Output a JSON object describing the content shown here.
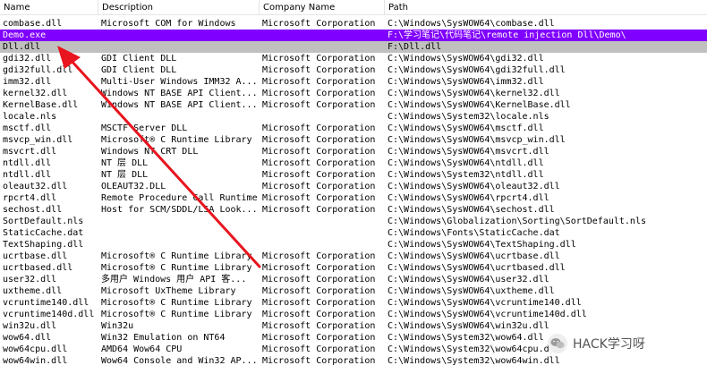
{
  "columns": [
    "Name",
    "Description",
    "Company Name",
    "Path"
  ],
  "rows": [
    {
      "name": "combase.dll",
      "description": "Microsoft COM for Windows",
      "company": "Microsoft Corporation",
      "path": "C:\\Windows\\SysWOW64\\combase.dll"
    },
    {
      "name": "Demo.exe",
      "description": "",
      "company": "",
      "path": "F:\\学习笔记\\代码笔记\\remote injection Dll\\Demo\\",
      "highlight": "purple"
    },
    {
      "name": "Dll.dll",
      "description": "",
      "company": "",
      "path": "F:\\Dll.dll",
      "highlight": "gray"
    },
    {
      "name": "gdi32.dll",
      "description": "GDI Client DLL",
      "company": "Microsoft Corporation",
      "path": "C:\\Windows\\SysWOW64\\gdi32.dll"
    },
    {
      "name": "gdi32full.dll",
      "description": "GDI Client DLL",
      "company": "Microsoft Corporation",
      "path": "C:\\Windows\\SysWOW64\\gdi32full.dll"
    },
    {
      "name": "imm32.dll",
      "description": "Multi-User Windows IMM32 A...",
      "company": "Microsoft Corporation",
      "path": "C:\\Windows\\SysWOW64\\imm32.dll"
    },
    {
      "name": "kernel32.dll",
      "description": "Windows NT BASE API Client...",
      "company": "Microsoft Corporation",
      "path": "C:\\Windows\\SysWOW64\\kernel32.dll"
    },
    {
      "name": "KernelBase.dll",
      "description": "Windows NT BASE API Client...",
      "company": "Microsoft Corporation",
      "path": "C:\\Windows\\SysWOW64\\KernelBase.dll"
    },
    {
      "name": "locale.nls",
      "description": "",
      "company": "",
      "path": "C:\\Windows\\System32\\locale.nls"
    },
    {
      "name": "msctf.dll",
      "description": "MSCTF Server DLL",
      "company": "Microsoft Corporation",
      "path": "C:\\Windows\\SysWOW64\\msctf.dll"
    },
    {
      "name": "msvcp_win.dll",
      "description": "Microsoft® C Runtime Library",
      "company": "Microsoft Corporation",
      "path": "C:\\Windows\\SysWOW64\\msvcp_win.dll"
    },
    {
      "name": "msvcrt.dll",
      "description": "Windows NT CRT DLL",
      "company": "Microsoft Corporation",
      "path": "C:\\Windows\\SysWOW64\\msvcrt.dll"
    },
    {
      "name": "ntdll.dll",
      "description": "NT 层 DLL",
      "company": "Microsoft Corporation",
      "path": "C:\\Windows\\SysWOW64\\ntdll.dll"
    },
    {
      "name": "ntdll.dll",
      "description": "NT 层 DLL",
      "company": "Microsoft Corporation",
      "path": "C:\\Windows\\System32\\ntdll.dll"
    },
    {
      "name": "oleaut32.dll",
      "description": "OLEAUT32.DLL",
      "company": "Microsoft Corporation",
      "path": "C:\\Windows\\SysWOW64\\oleaut32.dll"
    },
    {
      "name": "rpcrt4.dll",
      "description": "Remote Procedure Call Runtime",
      "company": "Microsoft Corporation",
      "path": "C:\\Windows\\SysWOW64\\rpcrt4.dll"
    },
    {
      "name": "sechost.dll",
      "description": "Host for SCM/SDDL/LSA Look...",
      "company": "Microsoft Corporation",
      "path": "C:\\Windows\\SysWOW64\\sechost.dll"
    },
    {
      "name": "SortDefault.nls",
      "description": "",
      "company": "",
      "path": "C:\\Windows\\Globalization\\Sorting\\SortDefault.nls"
    },
    {
      "name": "StaticCache.dat",
      "description": "",
      "company": "",
      "path": "C:\\Windows\\Fonts\\StaticCache.dat"
    },
    {
      "name": "TextShaping.dll",
      "description": "",
      "company": "",
      "path": "C:\\Windows\\SysWOW64\\TextShaping.dll"
    },
    {
      "name": "ucrtbase.dll",
      "description": "Microsoft® C Runtime Library",
      "company": "Microsoft Corporation",
      "path": "C:\\Windows\\SysWOW64\\ucrtbase.dll"
    },
    {
      "name": "ucrtbased.dll",
      "description": "Microsoft® C Runtime Library",
      "company": "Microsoft Corporation",
      "path": "C:\\Windows\\SysWOW64\\ucrtbased.dll"
    },
    {
      "name": "user32.dll",
      "description": "多用户 Windows 用户 API 客...",
      "company": "Microsoft Corporation",
      "path": "C:\\Windows\\SysWOW64\\user32.dll"
    },
    {
      "name": "uxtheme.dll",
      "description": "Microsoft UxTheme Library",
      "company": "Microsoft Corporation",
      "path": "C:\\Windows\\SysWOW64\\uxtheme.dll"
    },
    {
      "name": "vcruntime140.dll",
      "description": "Microsoft® C Runtime Library",
      "company": "Microsoft Corporation",
      "path": "C:\\Windows\\SysWOW64\\vcruntime140.dll"
    },
    {
      "name": "vcruntime140d.dll",
      "description": "Microsoft® C Runtime Library",
      "company": "Microsoft Corporation",
      "path": "C:\\Windows\\SysWOW64\\vcruntime140d.dll"
    },
    {
      "name": "win32u.dll",
      "description": "Win32u",
      "company": "Microsoft Corporation",
      "path": "C:\\Windows\\SysWOW64\\win32u.dll"
    },
    {
      "name": "wow64.dll",
      "description": "Win32 Emulation on NT64",
      "company": "Microsoft Corporation",
      "path": "C:\\Windows\\System32\\wow64.dll"
    },
    {
      "name": "wow64cpu.dll",
      "description": "AMD64 Wow64 CPU",
      "company": "Microsoft Corporation",
      "path": "C:\\Windows\\System32\\wow64cpu.dll"
    },
    {
      "name": "wow64win.dll",
      "description": "Wow64 Console and Win32 AP...",
      "company": "Microsoft Corporation",
      "path": "C:\\Windows\\System32\\wow64win.dll"
    }
  ],
  "colors": {
    "selected_purple": "#8000ff",
    "selected_gray": "#c0c0c0",
    "arrow": "#e8141e"
  },
  "annotation_arrow": {
    "color": "#e8141e",
    "points_to": "Dll.dll"
  },
  "watermark": {
    "text": "HACK学习呀",
    "icon": "wechat-icon"
  }
}
